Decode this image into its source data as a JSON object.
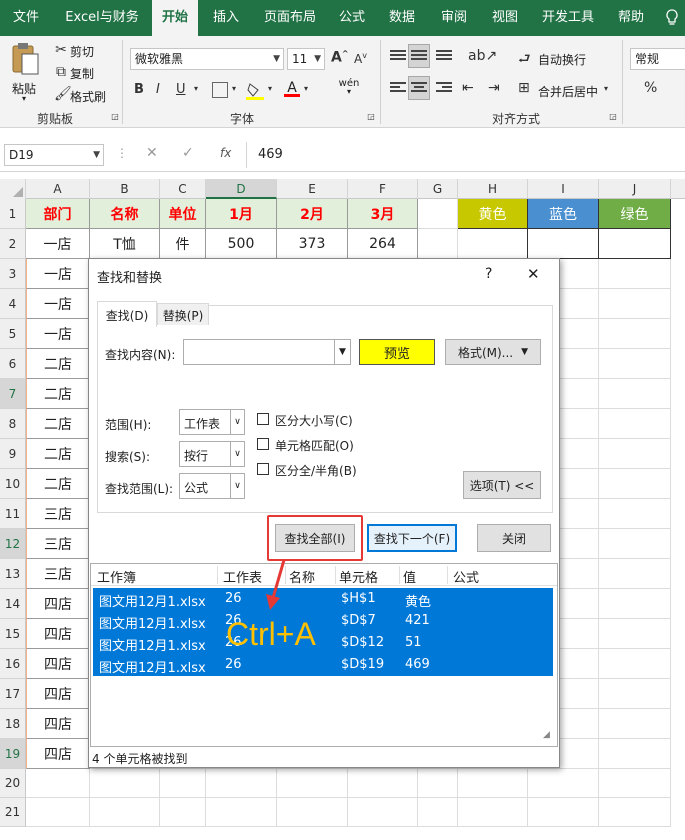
{
  "ribbon_tabs": [
    "文件",
    "Excel与财务",
    "开始",
    "插入",
    "页面布局",
    "公式",
    "数据",
    "审阅",
    "视图",
    "开发工具",
    "帮助"
  ],
  "clipboard": {
    "paste": "粘贴",
    "cut": "剪切",
    "copy": "复制",
    "format_painter": "格式刷",
    "group": "剪贴板"
  },
  "font": {
    "name": "微软雅黑",
    "size": "11",
    "group": "字体",
    "bold": "B",
    "italic": "I",
    "underline": "U",
    "grow": "A",
    "shrink": "A",
    "font_color_glyph": "A",
    "phonetic_glyph": "wén"
  },
  "alignment": {
    "wrap": "自动换行",
    "merge": "合并后居中",
    "group": "对齐方式"
  },
  "number": {
    "format": "常规",
    "percent": "%"
  },
  "formula_bar": {
    "name_box": "D19",
    "fx": "fx",
    "value": "469"
  },
  "columns": [
    "A",
    "B",
    "C",
    "D",
    "E",
    "F",
    "G",
    "H",
    "I",
    "J"
  ],
  "rows": [
    "1",
    "2",
    "3",
    "4",
    "5",
    "6",
    "7",
    "8",
    "9",
    "10",
    "11",
    "12",
    "13",
    "14",
    "15",
    "16",
    "17",
    "18",
    "19",
    "20",
    "21"
  ],
  "header_row": [
    "部门",
    "名称",
    "单位",
    "1月",
    "2月",
    "3月"
  ],
  "row2": [
    "一店",
    "T恤",
    "件",
    "500",
    "373",
    "264"
  ],
  "col_a_values": [
    "一店",
    "一店",
    "一店",
    "二店",
    "二店",
    "二店",
    "二店",
    "二店",
    "三店",
    "三店",
    "三店",
    "四店",
    "四店",
    "四店",
    "四店",
    "四店",
    "四店"
  ],
  "color_headers": [
    {
      "label": "黄色",
      "bg": "#c8c800"
    },
    {
      "label": "蓝色",
      "bg": "#4a8fd0"
    },
    {
      "label": "绿色",
      "bg": "#70ad47"
    }
  ],
  "dialog": {
    "title": "查找和替换",
    "help": "?",
    "close": "✕",
    "tab_find": "查找(D)",
    "tab_replace": "替换(P)",
    "find_label": "查找内容(N):",
    "find_value": "",
    "preview": "预览",
    "format_btn": "格式(M)...",
    "scope_label": "范围(H):",
    "scope_value": "工作表",
    "search_label": "搜索(S):",
    "search_value": "按行",
    "lookin_label": "查找范围(L):",
    "lookin_value": "公式",
    "match_case": "区分大小写(C)",
    "match_cell": "单元格匹配(O)",
    "match_width": "区分全/半角(B)",
    "options_btn": "选项(T) <<",
    "find_all": "查找全部(I)",
    "find_next": "查找下一个(F)",
    "close_btn": "关闭",
    "result_headers": [
      "工作簿",
      "工作表",
      "名称",
      "单元格",
      "值",
      "公式"
    ],
    "results": [
      [
        "图文用12月1.xlsx",
        "26",
        "",
        "$H$1",
        "黄色",
        ""
      ],
      [
        "图文用12月1.xlsx",
        "26",
        "",
        "$D$7",
        "421",
        ""
      ],
      [
        "图文用12月1.xlsx",
        "26",
        "",
        "$D$12",
        "51",
        ""
      ],
      [
        "图文用12月1.xlsx",
        "26",
        "",
        "$D$19",
        "469",
        ""
      ]
    ],
    "status": "4 个单元格被找到"
  },
  "annotation": "Ctrl+A",
  "colors": {
    "excel_green": "#217346",
    "header_fill": "#e2efda",
    "header_text": "#ff0000",
    "select_blue": "#0078d7",
    "highlight_red": "#e53935",
    "annotation": "#ffc000"
  }
}
